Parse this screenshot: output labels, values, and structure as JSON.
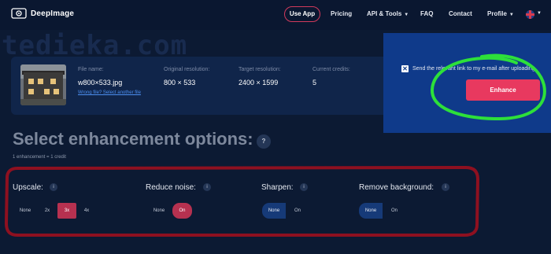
{
  "nav": {
    "logo_text": "DeepImage",
    "use_app": "Use App",
    "pricing": "Pricing",
    "api_tools": "API & Tools",
    "faq": "FAQ",
    "contact": "Contact",
    "profile": "Profile"
  },
  "watermark": "tediekа.com",
  "file": {
    "file_name_label": "File name:",
    "file_name": "w800×533.jpg",
    "wrong_file_link": "Wrong file? Select another file",
    "original_label": "Original resolution:",
    "original_value": "800 × 533",
    "target_label": "Target resolution:",
    "target_value": "2400 × 1599",
    "credits_label": "Current credits:",
    "credits_value": "5"
  },
  "send_option": {
    "checked": true,
    "check_mark": "✕",
    "label": "Send the relevant link to my e-mail after uploading"
  },
  "enhance_button": "Enhance",
  "section": {
    "title": "Select enhancement options:",
    "help": "?",
    "credit_note": "1 enhancement = 1 credit"
  },
  "options": {
    "info_glyph": "i",
    "upscale": {
      "title": "Upscale:",
      "choices": [
        "None",
        "2x",
        "3x",
        "4x"
      ],
      "selected": "3x"
    },
    "reduce_noise": {
      "title": "Reduce noise:",
      "choices": [
        "None",
        "On"
      ],
      "selected": "On"
    },
    "sharpen": {
      "title": "Sharpen:",
      "choices": [
        "None",
        "On"
      ],
      "selected": "None"
    },
    "remove_background": {
      "title": "Remove background:",
      "choices": [
        "None",
        "On"
      ],
      "selected": "None"
    }
  },
  "colors": {
    "background": "#0c1a33",
    "accent": "#e8395f",
    "annotation_green": "#2de03a",
    "annotation_red": "#8e1020",
    "selected_blue": "#163a78"
  }
}
